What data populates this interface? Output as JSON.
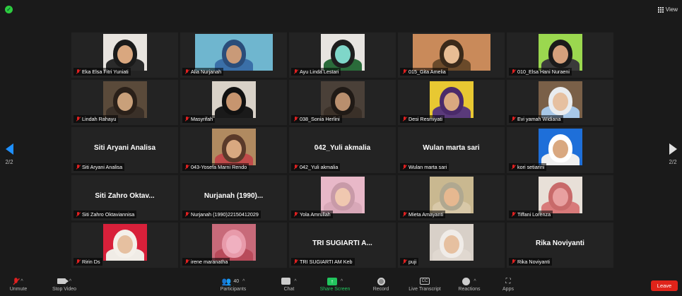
{
  "header": {
    "view_label": "View"
  },
  "nav": {
    "page_indicator": "2/2"
  },
  "participants": [
    {
      "label": "Eka Elsa Fitri Yuniati",
      "big_name": "",
      "video": {
        "bg": "#e8e4df",
        "head": "#1a1a1a",
        "body": "#2a2a2a",
        "face": "#d9a77f"
      }
    },
    {
      "label": "Alia Nurjanah",
      "big_name": "",
      "video": {
        "bg": "#6fb6cf",
        "head": "#2a4d7a",
        "body": "#3a6fa8",
        "face": "#c99a78"
      },
      "wide": true
    },
    {
      "label": "Ayu Linda Lestari",
      "big_name": "",
      "video": {
        "bg": "#e7e4e0",
        "head": "#1e1e1e",
        "body": "#2a6b3a",
        "face": "#7fd7c9"
      }
    },
    {
      "label": "015_Gita Amelia",
      "big_name": "",
      "video": {
        "bg": "#c98a5a",
        "head": "#3a2a1a",
        "body": "#6a4a2a",
        "face": "#e7bd94"
      },
      "wide": true
    },
    {
      "label": "010_Elsa Hani Nuraeni",
      "big_name": "",
      "video": {
        "bg": "#9bd84f",
        "head": "#1a1a1a",
        "body": "#3a3a3a",
        "face": "#d5a07c"
      }
    },
    {
      "label": "Lindah Rahayu",
      "big_name": "",
      "video": {
        "bg": "#5a4a3a",
        "head": "#2a2019",
        "body": "#3a3028",
        "face": "#c9a07a"
      }
    },
    {
      "label": "Masyrifah",
      "big_name": "",
      "video": {
        "bg": "#d9d2c8",
        "head": "#111111",
        "body": "#1a1a1a",
        "face": "#c7956f"
      }
    },
    {
      "label": "038_Sonia Herlini",
      "big_name": "",
      "video": {
        "bg": "#4a4038",
        "head": "#201a16",
        "body": "#3a3028",
        "face": "#b98f6e"
      }
    },
    {
      "label": "Desi Resmiyati",
      "big_name": "",
      "video": {
        "bg": "#e8c832",
        "head": "#4a2a6a",
        "body": "#5a3a7a",
        "face": "#d9a880"
      }
    },
    {
      "label": "Evi yamah Widiana",
      "big_name": "",
      "video": {
        "bg": "#7a6048",
        "head": "#e9ecef",
        "body": "#a8c8e8",
        "face": "#e6c0a0"
      }
    },
    {
      "label": "Siti Aryani Analisa",
      "big_name": "Siti Aryani Analisa",
      "video": null
    },
    {
      "label": "043-Yosefa Marni Rendo",
      "big_name": "",
      "video": {
        "bg": "#b08a60",
        "head": "#5a3a2a",
        "body": "#c04a4a",
        "face": "#d9a880"
      }
    },
    {
      "label": "042_Yuli akmalia",
      "big_name": "042_Yuli akmalia",
      "video": null
    },
    {
      "label": "Wulan marta sari",
      "big_name": "Wulan marta sari",
      "video": null
    },
    {
      "label": "kori setiarini",
      "big_name": "",
      "video": {
        "bg": "#1e6fd9",
        "head": "#ffffff",
        "body": "#f0f0f0",
        "face": "#d9a880"
      }
    },
    {
      "label": "Siti Zahro Oktaviannisa",
      "big_name": "Siti Zahro Oktav...",
      "video": null
    },
    {
      "label": "Nurjanah (1990)22150412029",
      "big_name": "Nurjanah (1990)...",
      "video": null
    },
    {
      "label": "Yola Amrullah",
      "big_name": "",
      "video": {
        "bg": "#e8b8c8",
        "head": "#c89aa8",
        "body": "#d8a8b8",
        "face": "#f0c8b0"
      }
    },
    {
      "label": "Mieta Amayanti",
      "big_name": "",
      "video": {
        "bg": "#c9b890",
        "head": "#b0a890",
        "body": "#d8c8a8",
        "face": "#e6b890"
      }
    },
    {
      "label": "Tiffani Lorenza",
      "big_name": "",
      "video": {
        "bg": "#e8e0d8",
        "head": "#c86a6a",
        "body": "#d87a7a",
        "face": "#e8a0a0"
      }
    },
    {
      "label": "Ririn Ds",
      "big_name": "",
      "video": {
        "bg": "#d8203a",
        "head": "#f4f0ea",
        "body": "#f0ece6",
        "face": "#e6c0a0"
      }
    },
    {
      "label": "irene maranatha",
      "big_name": "",
      "video": {
        "bg": "#c86a7a",
        "head": "#e89aaa",
        "body": "#b84a5a",
        "face": "#f0b0c0"
      }
    },
    {
      "label": "TRI SUGIARTI AM Keb",
      "big_name": "TRI SUGIARTI A...",
      "video": null
    },
    {
      "label": "puji",
      "big_name": "",
      "video": {
        "bg": "#d8d0c8",
        "head": "#f0ece8",
        "body": "#e0d8d0",
        "face": "#e6c0a0"
      }
    },
    {
      "label": "Rika Noviyanti",
      "big_name": "Rika Noviyanti",
      "video": null
    }
  ],
  "toolbar": {
    "unmute": "Unmute",
    "stop_video": "Stop Video",
    "participants": "Participants",
    "participant_count": "40",
    "chat": "Chat",
    "share_screen": "Share Screen",
    "record": "Record",
    "live_transcript": "Live Transcript",
    "cc": "CC",
    "reactions": "Reactions",
    "apps": "Apps",
    "leave": "Leave"
  },
  "colors": {
    "background": "#1a1a1a",
    "tile": "#232323",
    "leave": "#e0241a",
    "share": "#22c55e",
    "muted": "#e02020"
  }
}
